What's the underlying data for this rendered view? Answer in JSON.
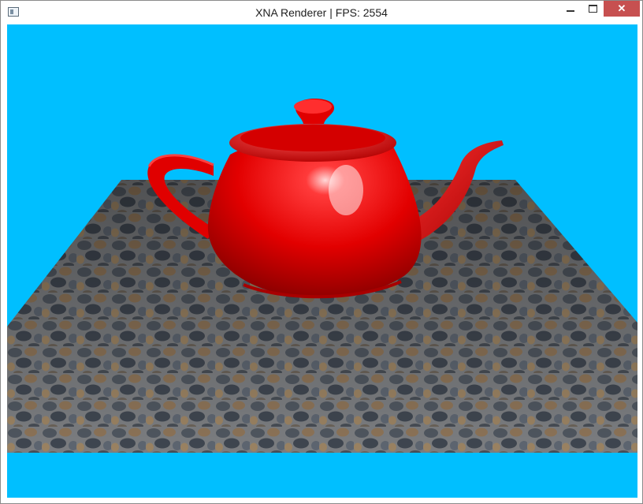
{
  "window": {
    "title": "XNA Renderer | FPS: 2554",
    "close_glyph": "✕"
  },
  "scene": {
    "clear_color": "#00BFFF",
    "teapot_color": "#E00000",
    "floor_texture": "cobblestone"
  },
  "icons": {
    "app": "window-app-icon",
    "minimize": "minimize-icon",
    "maximize": "maximize-icon",
    "close": "close-icon"
  }
}
